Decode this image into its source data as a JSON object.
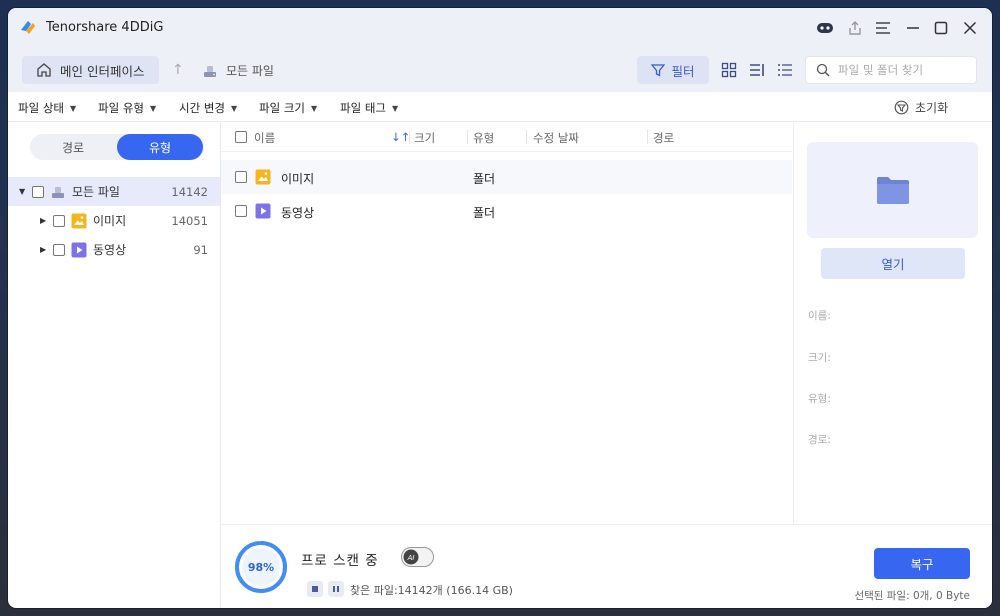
{
  "app": {
    "title": "Tenorshare 4DDiG"
  },
  "nav": {
    "home_label": "메인 인터페이스",
    "breadcrumb": "모든 파일",
    "filter_label": "필터",
    "search_placeholder": "파일 및 폴더 찾기"
  },
  "filters": {
    "items": [
      "파일 상태",
      "파일 유형",
      "시간 변경",
      "파일 크기",
      "파일 태그"
    ],
    "reset_label": "초기화"
  },
  "sidebar": {
    "toggle": {
      "path": "경로",
      "type": "유형"
    },
    "tree": [
      {
        "label": "모든 파일",
        "count": "14142"
      },
      {
        "label": "이미지",
        "count": "14051"
      },
      {
        "label": "동영상",
        "count": "91"
      }
    ]
  },
  "list": {
    "headers": {
      "name": "이름",
      "size": "크기",
      "type": "유형",
      "modified": "수정 날짜",
      "path": "경로"
    },
    "rows": [
      {
        "name": "이미지",
        "type": "폴더",
        "icon": "image-folder-icon"
      },
      {
        "name": "동영상",
        "type": "폴더",
        "icon": "video-folder-icon"
      }
    ]
  },
  "preview": {
    "open_label": "열기",
    "name_label": "이름:",
    "size_label": "크기:",
    "type_label": "유형:",
    "path_label": "경로:"
  },
  "scan": {
    "percent": "98%",
    "progress": 0.98,
    "title": "프로 스캔 중",
    "ai_label": "AI",
    "found_text": "찾은 파일:14142개 (166.14 GB)",
    "recover_label": "복구",
    "selected_text": "선택된 파일: 0개, 0 Byte"
  },
  "colors": {
    "accent": "#3766f0",
    "image_icon": "#f6b41e",
    "video_icon": "#7c73e6"
  }
}
